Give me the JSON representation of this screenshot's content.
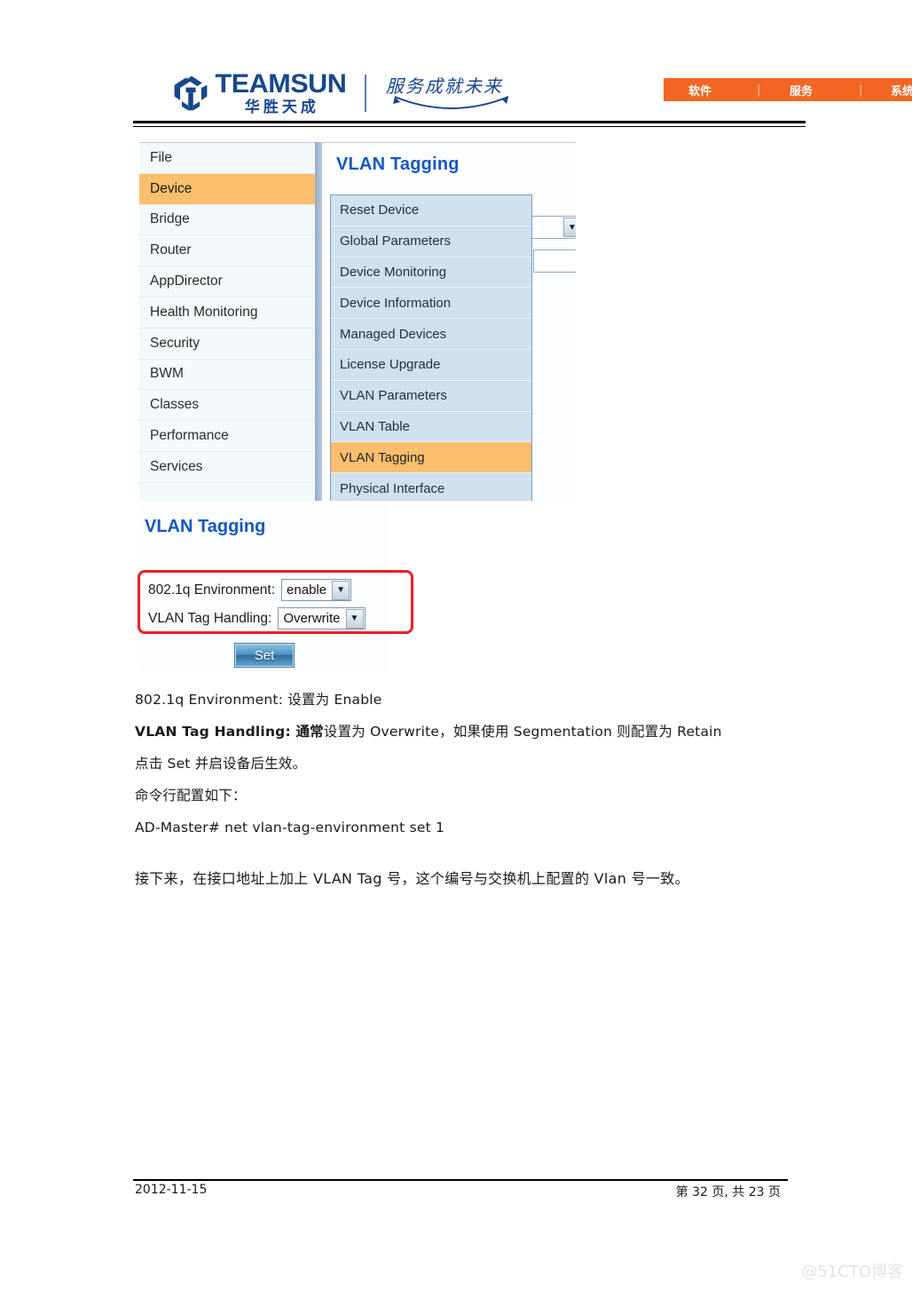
{
  "header": {
    "logo": {
      "brand_latin": "TEAMSUN",
      "brand_cn": "华胜天成",
      "slogan": "服务成就未来"
    },
    "nav": {
      "items": [
        "软件",
        "服务",
        "系统及产"
      ],
      "separator": "|",
      "background_color": "#F26522"
    }
  },
  "screenshot": {
    "left_menu": {
      "items": [
        {
          "label": "File",
          "selected": false
        },
        {
          "label": "Device",
          "selected": true
        },
        {
          "label": "Bridge",
          "selected": false
        },
        {
          "label": "Router",
          "selected": false
        },
        {
          "label": "AppDirector",
          "selected": false
        },
        {
          "label": "Health Monitoring",
          "selected": false
        },
        {
          "label": "Security",
          "selected": false
        },
        {
          "label": "BWM",
          "selected": false
        },
        {
          "label": "Classes",
          "selected": false
        },
        {
          "label": "Performance",
          "selected": false
        },
        {
          "label": "Services",
          "selected": false
        }
      ]
    },
    "panel_title": "VLAN Tagging",
    "dropdown_menu": {
      "items": [
        {
          "label": "Reset Device",
          "selected": false
        },
        {
          "label": "Global Parameters",
          "selected": false
        },
        {
          "label": "Device Monitoring",
          "selected": false
        },
        {
          "label": "Device Information",
          "selected": false
        },
        {
          "label": "Managed Devices",
          "selected": false
        },
        {
          "label": "License Upgrade",
          "selected": false
        },
        {
          "label": "VLAN Parameters",
          "selected": false
        },
        {
          "label": "VLAN Table",
          "selected": false
        },
        {
          "label": "VLAN Tagging",
          "selected": true
        },
        {
          "label": "Physical Interface",
          "selected": false
        }
      ]
    },
    "highlight_color": "#FABE6C",
    "menu_background": "#CFE0EE"
  },
  "form": {
    "title": "VLAN Tagging",
    "fields": [
      {
        "label": "802.1q Environment:",
        "value": "enable"
      },
      {
        "label": "VLAN Tag Handling:",
        "value": "Overwrite"
      }
    ],
    "submit_label": "Set",
    "callout_color": "#EE1C25"
  },
  "body": {
    "lines": [
      {
        "plain": "802.1q Environment: 设置为 Enable"
      },
      {
        "bold": "VLAN Tag Handling: 通常",
        "plain": "设置为 Overwrite，如果使用 Segmentation 则配置为 Retain"
      },
      {
        "plain": "点击 Set 并启设备后生效。"
      },
      {
        "plain": "命令行配置如下："
      },
      {
        "plain": "AD-Master# net vlan-tag-environment set 1"
      }
    ],
    "final_paragraph": "接下来，在接口地址上加上 VLAN Tag 号，这个编号与交换机上配置的 Vlan 号一致。"
  },
  "footer": {
    "date": "2012-11-15",
    "page_info": "第 32 页, 共 23 页"
  },
  "watermark": "@51CTO博客"
}
